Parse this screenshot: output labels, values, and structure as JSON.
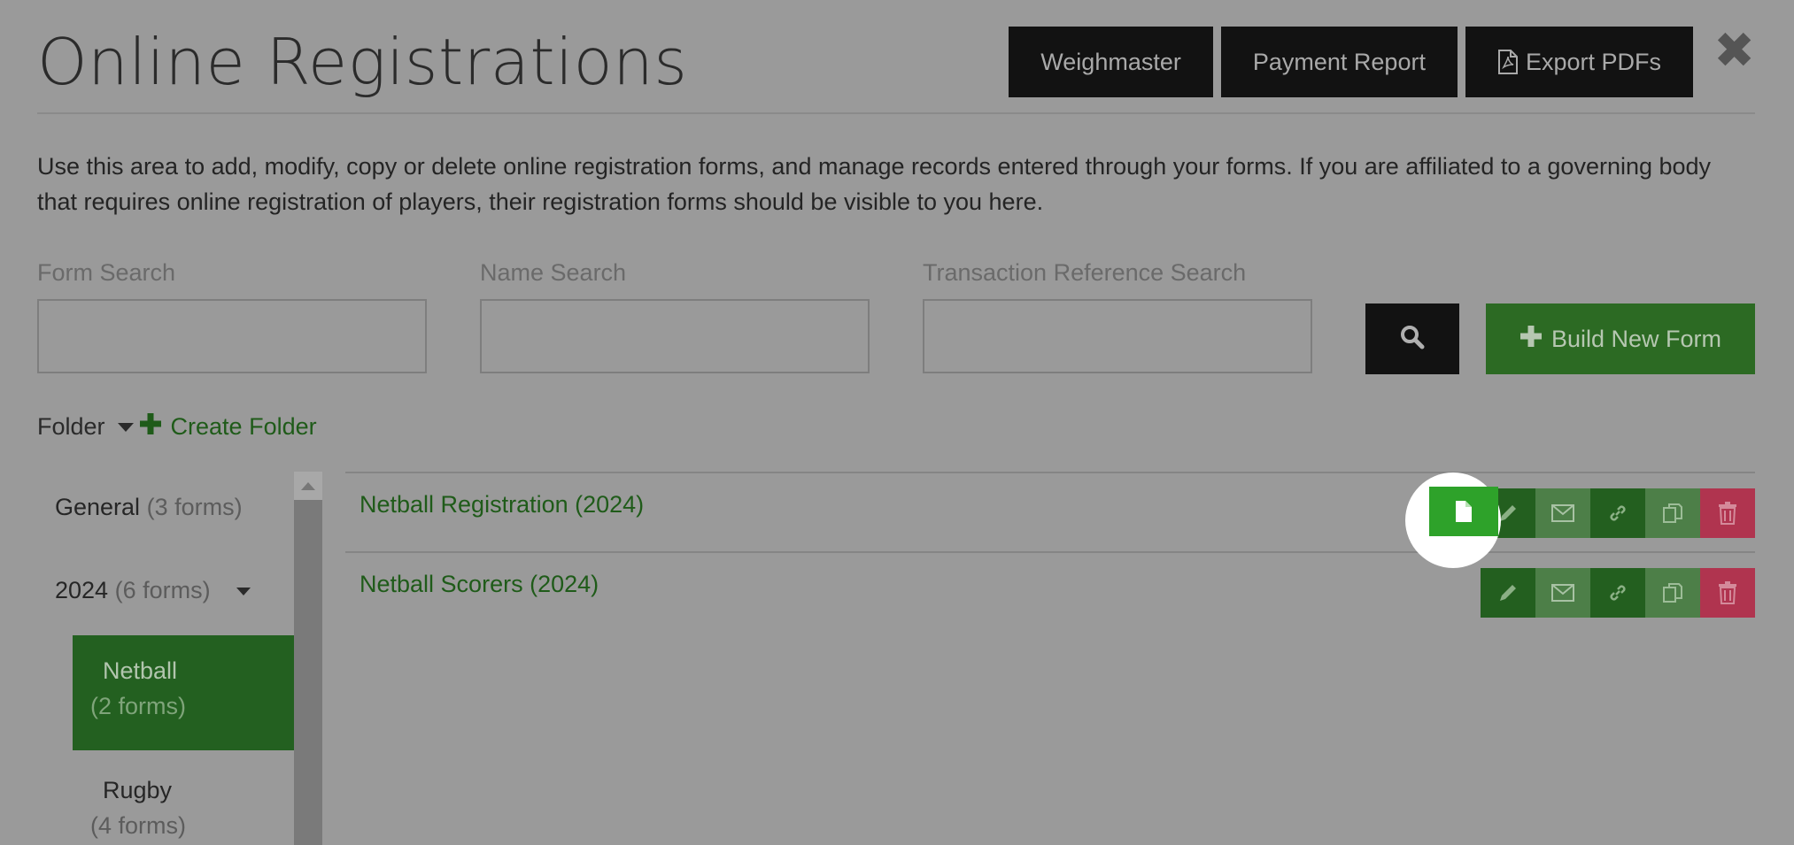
{
  "header": {
    "title": "Online Registrations",
    "buttons": {
      "weighmaster": "Weighmaster",
      "payment_report": "Payment Report",
      "export_pdfs": "Export PDFs"
    },
    "close_icon": "close-icon"
  },
  "intro_text": "Use this area to add, modify, copy or delete online registration forms, and manage records entered through your forms. If you are affiliated to a governing body that requires online registration of players, their registration forms should be visible to you here.",
  "search": {
    "form_label": "Form Search",
    "form_value": "",
    "name_label": "Name Search",
    "name_value": "",
    "transaction_label": "Transaction Reference Search",
    "transaction_value": "",
    "search_icon": "search-icon"
  },
  "build_button": "Build New Form",
  "folder_bar": {
    "label": "Folder",
    "create_label": "Create Folder"
  },
  "sidebar": {
    "general": {
      "name": "General",
      "count": "(3 forms)"
    },
    "year": {
      "name": "2024",
      "count": "(6 forms)"
    },
    "netball": {
      "name": "Netball",
      "count": "(2 forms)"
    },
    "rugby": {
      "name": "Rugby",
      "count": "(4 forms)"
    }
  },
  "forms": [
    {
      "name": "Netball Registration (2024)"
    },
    {
      "name": "Netball Scorers (2024)"
    }
  ],
  "colors": {
    "overlay": "#9a9a9a",
    "brand_green": "#2c6a23",
    "highlight_green": "#2ea22a",
    "delete_red": "#b0344f",
    "dark_button": "#121212"
  }
}
